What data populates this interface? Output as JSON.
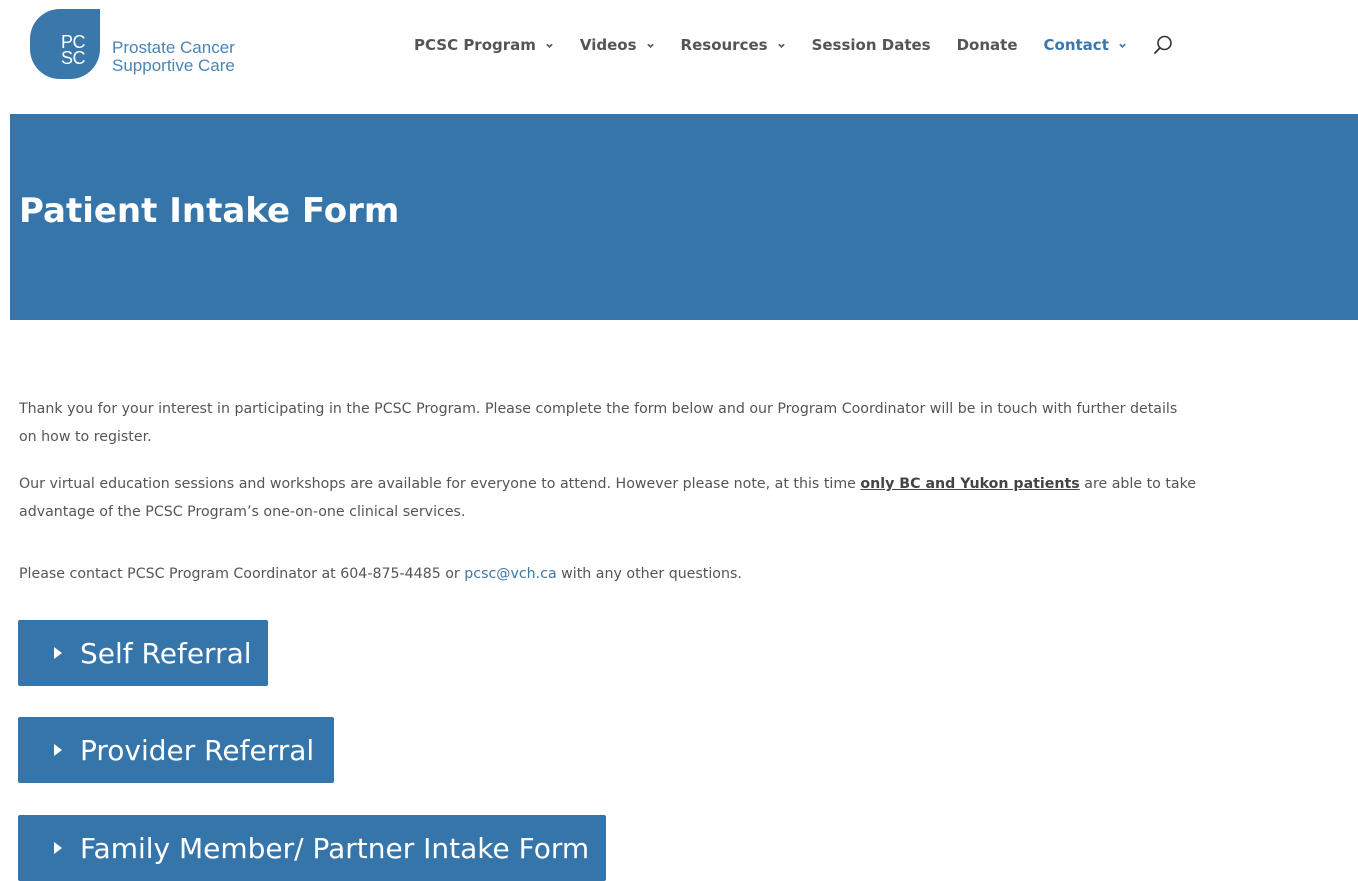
{
  "logo": {
    "mark_line1": "PC",
    "mark_line2": "SC",
    "text_line1": "Prostate Cancer",
    "text_line2": "Supportive Care",
    "color": "#3a77ab"
  },
  "nav": {
    "items": [
      {
        "label": "PCSC Program",
        "has_dropdown": true,
        "active": false
      },
      {
        "label": "Videos",
        "has_dropdown": true,
        "active": false
      },
      {
        "label": "Resources",
        "has_dropdown": true,
        "active": false
      },
      {
        "label": "Session Dates",
        "has_dropdown": false,
        "active": false
      },
      {
        "label": "Donate",
        "has_dropdown": false,
        "active": false
      },
      {
        "label": "Contact",
        "has_dropdown": true,
        "active": true
      }
    ],
    "search_icon": "search-icon",
    "dropdown_icon": "chevron-down-icon"
  },
  "banner": {
    "title": "Patient Intake Form",
    "background": "#3675aa"
  },
  "content": {
    "p1": "Thank you for your interest in participating in the PCSC Program. Please complete the form below and our Program Coordinator will be in touch with further details on how to register.",
    "p2_before": "Our virtual education sessions and workshops are available for everyone to attend. However please note, at this time ",
    "p2_link": "only BC and Yukon patients",
    "p2_after": " are able to take advantage of the PCSC Program’s one-on-one clinical services.",
    "p3_before": "Please contact PCSC Program Coordinator at 604-875-4485 or ",
    "p3_email": "pcsc@vch.ca",
    "p3_after": " with any other questions."
  },
  "accordion": {
    "items": [
      {
        "label": "Self Referral",
        "expanded": false
      },
      {
        "label": "Provider Referral",
        "expanded": false
      },
      {
        "label": "Family Member/ Partner Intake Form",
        "expanded": false
      }
    ],
    "icon": "caret-right-icon"
  }
}
